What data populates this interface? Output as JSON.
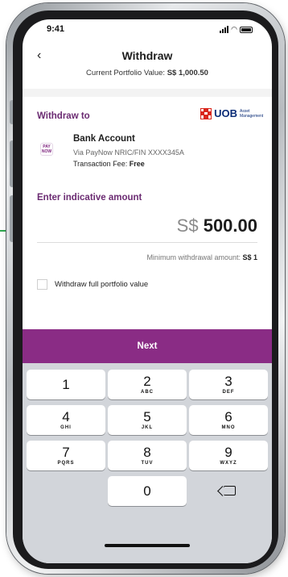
{
  "status_bar": {
    "time": "9:41"
  },
  "header": {
    "title": "Withdraw",
    "portfolio_prefix": "Current Portfolio Value: ",
    "portfolio_value": "S$ 1,000.50"
  },
  "withdraw_to": {
    "label": "Withdraw to",
    "bank_brand": "UOB",
    "bank_brand_tagline": "Asset Management",
    "paynow_icon_text": "PAY NOW",
    "account_name": "Bank Account",
    "via_text": "Via PayNow NRIC/FIN XXXX345A",
    "fee_prefix": "Transaction Fee: ",
    "fee_value": "Free"
  },
  "amount": {
    "label": "Enter indicative amount",
    "currency": "S$",
    "value": "500.00",
    "min_prefix": "Minimum withdrawal amount: ",
    "min_value": "S$ 1"
  },
  "full_value_checkbox": {
    "label": "Withdraw full portfolio value",
    "checked": false
  },
  "next_button": {
    "label": "Next"
  },
  "keypad": {
    "keys": [
      {
        "digit": "1",
        "letters": ""
      },
      {
        "digit": "2",
        "letters": "ABC"
      },
      {
        "digit": "3",
        "letters": "DEF"
      },
      {
        "digit": "4",
        "letters": "GHI"
      },
      {
        "digit": "5",
        "letters": "JKL"
      },
      {
        "digit": "6",
        "letters": "MNO"
      },
      {
        "digit": "7",
        "letters": "PQRS"
      },
      {
        "digit": "8",
        "letters": "TUV"
      },
      {
        "digit": "9",
        "letters": "WXYZ"
      },
      {
        "digit": "0",
        "letters": ""
      }
    ],
    "delete_icon": "backspace-icon"
  },
  "colors": {
    "brand_purple": "#8a2c85",
    "label_purple": "#6b2b72",
    "uob_red": "#d9261c",
    "uob_navy": "#0a2c77",
    "connector_green": "#2fa84f"
  }
}
